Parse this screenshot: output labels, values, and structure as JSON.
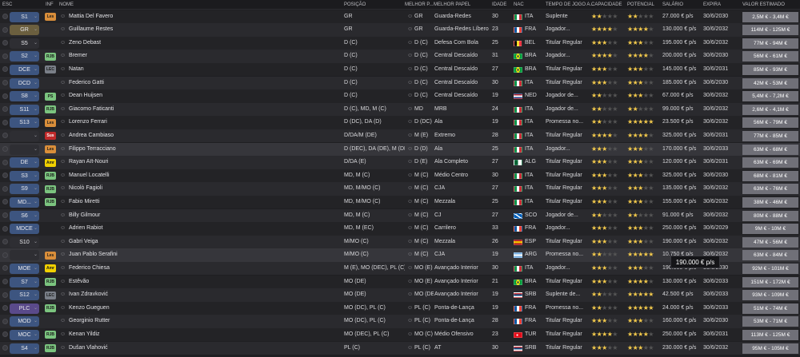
{
  "headers": {
    "esc": "ESC",
    "inf": "INF",
    "nome": "NOME",
    "posicao": "POSIÇÃO",
    "melhor_p": "MELHOR P...",
    "melhor_papel": "MELHOR PAPEL",
    "idade": "IDADE",
    "nac": "NAC",
    "tempo": "TEMPO DE JOGO A...",
    "capacidade": "CAPACIDADE",
    "potencial": "POTENCIAL",
    "salario": "SALÁRIO",
    "expira": "EXPIRA",
    "valor": "VALOR ESTIMADO"
  },
  "tooltip": "190.000 € p/s",
  "rows": [
    {
      "esc": "S1",
      "inf": "Les",
      "name": "Mattia Del Favero",
      "pos": "GR",
      "mp": "GR",
      "papel": "Guarda-Redes",
      "age": "30",
      "nac": "ITA",
      "tj": "Suplente",
      "cap": "★★",
      "cap_e": "★★★",
      "pot": "★★",
      "pot_e": "★★★",
      "sal": "27.000 € p/s",
      "exp": "30/6/2030",
      "val": "2,5M € - 3,4M €"
    },
    {
      "esc": "GR",
      "inf": "",
      "name": "Guillaume Restes",
      "pos": "GR",
      "mp": "GR",
      "papel": "Guarda-Redes Líbero",
      "age": "23",
      "nac": "FRA",
      "tj": "Jogador...",
      "cap": "★★★★",
      "cap_e": "★",
      "pot": "★★★★",
      "pot_e": "★",
      "sal": "130.000 € p/s",
      "exp": "30/6/2032",
      "val": "114M € - 125M €"
    },
    {
      "esc": "S5",
      "inf": "",
      "name": "Zeno Debast",
      "pos": "D (C)",
      "mp": "D (C)",
      "papel": "Defesa Com Bola",
      "age": "25",
      "nac": "BEL",
      "tj": "Titular Regular",
      "cap": "★★★",
      "cap_e": "★★",
      "pot": "★★★",
      "pot_e": "★★",
      "sal": "195.000 € p/s",
      "exp": "30/6/2032",
      "val": "77M € - 94M €"
    },
    {
      "esc": "S2",
      "inf": "RJB",
      "name": "Bremer",
      "pos": "D (C)",
      "mp": "D (C)",
      "papel": "Central Descaído",
      "age": "31",
      "nac": "BRA",
      "tj": "Jogador...",
      "cap": "★★★★",
      "cap_e": "★",
      "pot": "★★★★",
      "pot_e": "★",
      "sal": "200.000 € p/s",
      "exp": "30/6/2030",
      "val": "56M € - 61M €"
    },
    {
      "esc": "DCE",
      "inf": "LEC",
      "name": "Natan",
      "pos": "D (C)",
      "mp": "D (C)",
      "papel": "Central Descaído",
      "age": "27",
      "nac": "BRA",
      "tj": "Titular Regular",
      "cap": "★★★",
      "cap_e": "★★",
      "pot": "★★★",
      "pot_e": "★★",
      "sal": "145.000 € p/s",
      "exp": "30/6/2031",
      "val": "85M € - 93M €"
    },
    {
      "esc": "DCD",
      "inf": "",
      "name": "Federico Gatti",
      "pos": "D (C)",
      "mp": "D (C)",
      "papel": "Central Descaído",
      "age": "30",
      "nac": "ITA",
      "tj": "Titular Regular",
      "cap": "★★★",
      "cap_e": "★★",
      "pot": "★★★",
      "pot_e": "★★",
      "sal": "185.000 € p/s",
      "exp": "30/6/2030",
      "val": "42M € - 53M €"
    },
    {
      "esc": "S8",
      "inf": "PS",
      "name": "Dean Huijsen",
      "pos": "D (C)",
      "mp": "D (C)",
      "papel": "Central Descaído",
      "age": "19",
      "nac": "NED",
      "tj": "Jogador de...",
      "cap": "★★",
      "cap_e": "★★★",
      "pot": "★★★",
      "pot_e": "★★",
      "sal": "67.000 € p/s",
      "exp": "30/6/2032",
      "val": "5,4M € - 7,2M €"
    },
    {
      "esc": "S11",
      "inf": "RJB",
      "name": "Giacomo Faticanti",
      "pos": "D (C), MD, M (C)",
      "mp": "MD",
      "papel": "MRB",
      "age": "24",
      "nac": "ITA",
      "tj": "Jogador de...",
      "cap": "★★",
      "cap_e": "★★★",
      "pot": "★★",
      "pot_e": "★★★",
      "sal": "99.000 € p/s",
      "exp": "30/6/2032",
      "val": "2,6M € - 4,1M €"
    },
    {
      "esc": "S13",
      "inf": "Les",
      "name": "Lorenzo Ferrari",
      "pos": "D (DC), DA (D)",
      "mp": "D (DC)",
      "papel": "Ala",
      "age": "19",
      "nac": "ITA",
      "tj": "Promessa no...",
      "cap": "★★",
      "cap_e": "★★★",
      "pot": "★★★★★",
      "pot_e": "",
      "sal": "23.500 € p/s",
      "exp": "30/6/2032",
      "val": "56M € - 79M €"
    },
    {
      "esc": "",
      "inf": "Sus",
      "name": "Andrea Cambiaso",
      "pos": "D/DA/M (DE)",
      "mp": "M (E)",
      "papel": "Extremo",
      "age": "28",
      "nac": "ITA",
      "tj": "Titular Regular",
      "cap": "★★★★",
      "cap_e": "★",
      "pot": "★★★★",
      "pot_e": "★",
      "sal": "325.000 € p/s",
      "exp": "30/6/2031",
      "val": "77M € - 85M €"
    },
    {
      "esc": "",
      "inf": "Les",
      "name": "Filippo Terracciano",
      "pos": "D (DEC), DA (DE), M (DE)",
      "mp": "D (D)",
      "papel": "Ala",
      "age": "25",
      "nac": "ITA",
      "tj": "Jogador...",
      "cap": "★★★",
      "cap_e": "★★",
      "pot": "★★★",
      "pot_e": "★★",
      "sal": "170.000 € p/s",
      "exp": "30/6/2033",
      "val": "63M € - 68M €"
    },
    {
      "esc": "DE",
      "inf": "Amr",
      "name": "Rayan Aït-Nouri",
      "pos": "D/DA (E)",
      "mp": "D (E)",
      "papel": "Ala Completo",
      "age": "27",
      "nac": "ALG",
      "tj": "Titular Regular",
      "cap": "★★★",
      "cap_e": "★★",
      "pot": "★★★",
      "pot_e": "★★",
      "sal": "120.000 € p/s",
      "exp": "30/6/2031",
      "val": "63M € - 69M €"
    },
    {
      "esc": "S3",
      "inf": "RJB",
      "name": "Manuel Locatelli",
      "pos": "MD, M (C)",
      "mp": "M (C)",
      "papel": "Médio Centro",
      "age": "30",
      "nac": "ITA",
      "tj": "Titular Regular",
      "cap": "★★★",
      "cap_e": "★★",
      "pot": "★★★",
      "pot_e": "★★",
      "sal": "325.000 € p/s",
      "exp": "30/6/2030",
      "val": "68M € - 81M €"
    },
    {
      "esc": "S9",
      "inf": "RJB",
      "name": "Nicolò Fagioli",
      "pos": "MD, M/MO (C)",
      "mp": "M (C)",
      "papel": "CJA",
      "age": "27",
      "nac": "ITA",
      "tj": "Titular Regular",
      "cap": "★★★",
      "cap_e": "★★",
      "pot": "★★★",
      "pot_e": "★★",
      "sal": "135.000 € p/s",
      "exp": "30/6/2032",
      "val": "63M € - 76M €"
    },
    {
      "esc": "MD...",
      "inf": "RJB",
      "name": "Fabio Miretti",
      "pos": "MD, M/MO (C)",
      "mp": "M (C)",
      "papel": "Mezzala",
      "age": "25",
      "nac": "ITA",
      "tj": "Titular Regular",
      "cap": "★★★",
      "cap_e": "★★",
      "pot": "★★★",
      "pot_e": "★★",
      "sal": "155.000 € p/s",
      "exp": "30/6/2032",
      "val": "38M € - 46M €"
    },
    {
      "esc": "S6",
      "inf": "",
      "name": "Billy Gilmour",
      "pos": "MD, M (C)",
      "mp": "M (C)",
      "papel": "CJ",
      "age": "27",
      "nac": "SCO",
      "tj": "Jogador de...",
      "cap": "★★",
      "cap_e": "★★★",
      "pot": "★★",
      "pot_e": "★★★",
      "sal": "91.000 € p/s",
      "exp": "30/6/2032",
      "val": "80M € - 88M €"
    },
    {
      "esc": "MDCE",
      "inf": "",
      "name": "Adrien Rabiot",
      "pos": "MD, M (EC)",
      "mp": "M (C)",
      "papel": "Carrilero",
      "age": "33",
      "nac": "FRA",
      "tj": "Jogador...",
      "cap": "★★★",
      "cap_e": "★★",
      "pot": "★★★",
      "pot_e": "★★",
      "sal": "250.000 € p/s",
      "exp": "30/6/2029",
      "val": "9M € - 10M €"
    },
    {
      "esc": "S10",
      "inf": "",
      "name": "Gabri Veiga",
      "pos": "M/MO (C)",
      "mp": "M (C)",
      "papel": "Mezzala",
      "age": "26",
      "nac": "ESP",
      "tj": "Titular Regular",
      "cap": "★★★",
      "cap_e": "★★",
      "pot": "★★★",
      "pot_e": "★★",
      "sal": "190.000 € p/s",
      "exp": "30/6/2032",
      "val": "47M € - 56M €"
    },
    {
      "esc": "",
      "inf": "Les",
      "name": "Juan Pablo Serafini",
      "pos": "M/MO (C)",
      "mp": "M (C)",
      "papel": "CJA",
      "age": "19",
      "nac": "ARG",
      "tj": "Promessa no...",
      "cap": "★★",
      "cap_e": "★★★",
      "pot": "★★★★★",
      "pot_e": "",
      "sal": "10.750 € p/s",
      "exp": "30/6/2032",
      "val": "63M € - 84M €"
    },
    {
      "esc": "MOE",
      "inf": "Amr",
      "name": "Federico Chiesa",
      "pos": "M (E), MO (DEC), PL (C)",
      "mp": "MO (E)",
      "papel": "Avançado Interior",
      "age": "30",
      "nac": "ITA",
      "tj": "Jogador...",
      "cap": "★★★",
      "cap_e": "★★",
      "pot": "★★★",
      "pot_e": "★★",
      "sal": "190.000 € p/s",
      "exp": "30/6/2030",
      "val": "92M € - 101M €"
    },
    {
      "esc": "S7",
      "inf": "RJB",
      "name": "Estêvão",
      "pos": "MO (DE)",
      "mp": "MO (E)",
      "papel": "Avançado Interior",
      "age": "21",
      "nac": "BRA",
      "tj": "Titular Regular",
      "cap": "★★★",
      "cap_e": "★★",
      "pot": "★★★★",
      "pot_e": "★",
      "sal": "130.000 € p/s",
      "exp": "30/6/2033",
      "val": "151M € - 172M €"
    },
    {
      "esc": "S12",
      "inf": "LEC",
      "name": "Ivan Zdravković",
      "pos": "MO (DE)",
      "mp": "MO (DE)",
      "papel": "Avançado Interior",
      "age": "19",
      "nac": "SRB",
      "tj": "Suplente de...",
      "cap": "★★",
      "cap_e": "★★★",
      "pot": "★★★★★",
      "pot_e": "",
      "sal": "42.500 € p/s",
      "exp": "30/6/2033",
      "val": "93M € - 109M €"
    },
    {
      "esc": "PLC",
      "inf": "RJB",
      "name": "Kenzo Gueguen",
      "pos": "MO (DC), PL (C)",
      "mp": "PL (C)",
      "papel": "Ponta-de-Lança",
      "age": "19",
      "nac": "FRA",
      "tj": "Promessa no...",
      "cap": "★★",
      "cap_e": "★★★",
      "pot": "★★★★★",
      "pot_e": "",
      "sal": "24.000 € p/s",
      "exp": "30/6/2033",
      "val": "51M € - 74M €"
    },
    {
      "esc": "MOD",
      "inf": "",
      "name": "Georginio Rutter",
      "pos": "MO (DC), PL (C)",
      "mp": "PL (C)",
      "papel": "Ponta-de-Lança",
      "age": "28",
      "nac": "FRA",
      "tj": "Titular Regular",
      "cap": "★★★",
      "cap_e": "★★",
      "pot": "★★★",
      "pot_e": "★★",
      "sal": "160.000 € p/s",
      "exp": "30/6/2030",
      "val": "53M € - 71M €"
    },
    {
      "esc": "MOC",
      "inf": "RJB",
      "name": "Kenan Yildiz",
      "pos": "MO (DEC), PL (C)",
      "mp": "MO (C)",
      "papel": "Médio Ofensivo",
      "age": "23",
      "nac": "TUR",
      "tj": "Titular Regular",
      "cap": "★★★★",
      "cap_e": "★",
      "pot": "★★★★",
      "pot_e": "★",
      "sal": "250.000 € p/s",
      "exp": "30/6/2031",
      "val": "113M € - 125M €"
    },
    {
      "esc": "S4",
      "inf": "RJB",
      "name": "Dušan Vlahović",
      "pos": "PL (C)",
      "mp": "PL (C)",
      "papel": "AT",
      "age": "30",
      "nac": "SRB",
      "tj": "Titular Regular",
      "cap": "★★★",
      "cap_e": "★★",
      "pot": "★★★",
      "pot_e": "★★",
      "sal": "230.000 € p/s",
      "exp": "30/6/2032",
      "val": "95M € - 105M €"
    }
  ]
}
